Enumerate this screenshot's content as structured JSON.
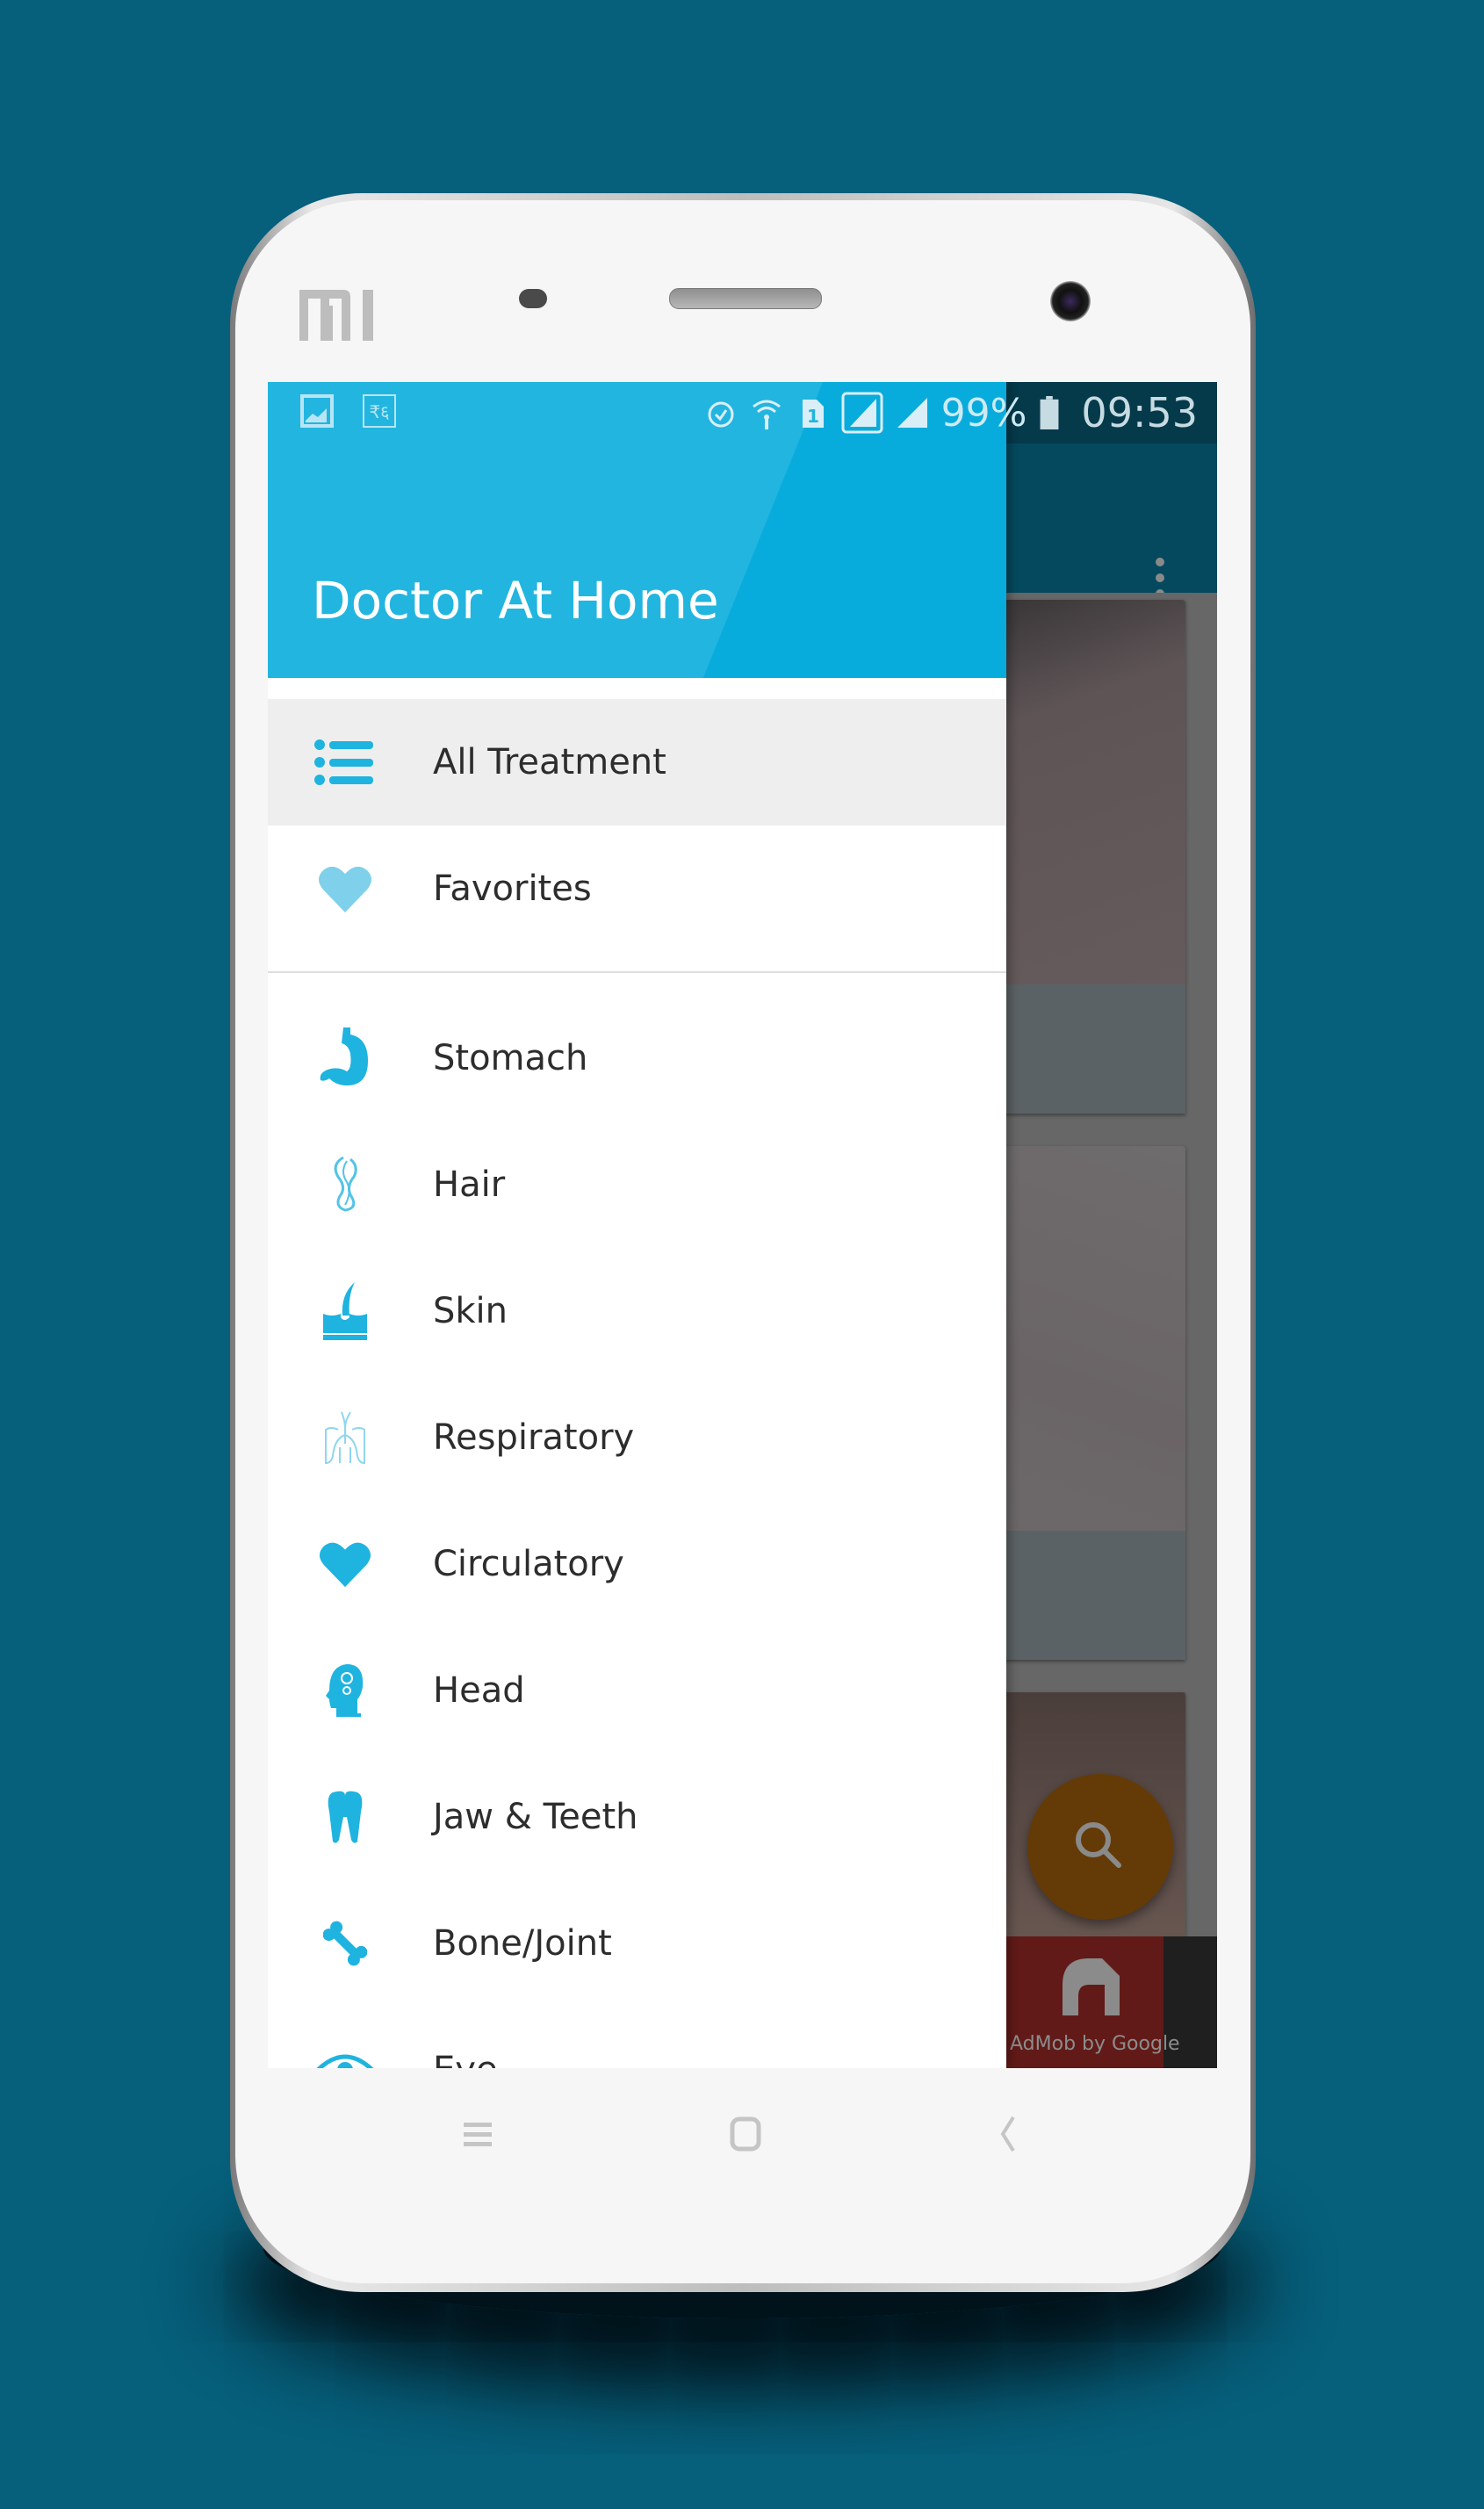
{
  "device": {
    "brand_logo": "MI"
  },
  "status_bar": {
    "left_icons": [
      "gallery-notification-icon",
      "rupee-notification-icon"
    ],
    "right_icons": [
      "alarm-icon",
      "wifi-icon",
      "sim-1-icon",
      "signal-1-icon",
      "signal-2-icon",
      "battery-icon"
    ],
    "battery": "99%",
    "time": "09:53"
  },
  "colors": {
    "accent": "#22b5e0",
    "accent_dark": "#08acdc",
    "background": "#065f7b",
    "fab": "#643b06",
    "icon": "#1fb3e0"
  },
  "drawer": {
    "title": "Doctor At Home",
    "primary_items": [
      {
        "label": "All Treatment",
        "icon": "list-icon",
        "active": true
      },
      {
        "label": "Favorites",
        "icon": "heart-icon",
        "active": false
      }
    ],
    "categories": [
      {
        "label": "Stomach",
        "icon": "stomach-icon"
      },
      {
        "label": "Hair",
        "icon": "hair-icon"
      },
      {
        "label": "Skin",
        "icon": "skin-icon"
      },
      {
        "label": "Respiratory",
        "icon": "lungs-icon"
      },
      {
        "label": "Circulatory",
        "icon": "heart-icon"
      },
      {
        "label": "Head",
        "icon": "head-icon"
      },
      {
        "label": "Jaw & Teeth",
        "icon": "tooth-icon"
      },
      {
        "label": "Bone/Joint",
        "icon": "bone-icon"
      },
      {
        "label": "Eye",
        "icon": "eye-icon"
      }
    ]
  },
  "background_app": {
    "fab": "search-icon",
    "ad_text": "AdMob by Google"
  },
  "nav_bar": {
    "buttons": [
      "menu-button",
      "home-button",
      "back-button"
    ]
  }
}
